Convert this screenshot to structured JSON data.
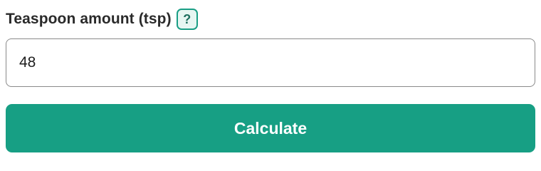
{
  "field": {
    "label": "Teaspoon amount (tsp)",
    "help_label": "?",
    "value": "48",
    "placeholder": ""
  },
  "actions": {
    "calculate_label": "Calculate"
  },
  "colors": {
    "accent": "#179f84",
    "help_border": "#1a9e85",
    "help_background": "#e7f6f2",
    "input_border": "#8a8a8a"
  }
}
